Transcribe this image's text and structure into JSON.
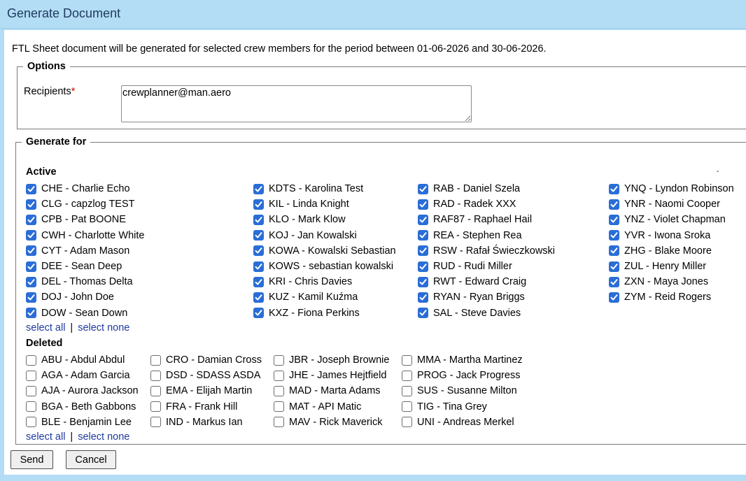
{
  "window": {
    "title": "Generate Document"
  },
  "description": "FTL Sheet document will be generated for selected crew members for the period between 01-06-2026 and 30-06-2026.",
  "options": {
    "legend": "Options",
    "recipients_label": "Recipients",
    "required_mark": "*",
    "recipients_value": "crewplanner@man.aero"
  },
  "generate_for": {
    "legend": "Generate for",
    "active": {
      "title": "Active",
      "columns": [
        [
          "CHE - Charlie Echo",
          "CLG - capzlog TEST",
          "CPB - Pat BOONE",
          "CWH - Charlotte White",
          "CYT - Adam Mason",
          "DEE - Sean Deep",
          "DEL - Thomas Delta",
          "DOJ - John Doe",
          "DOW - Sean Down"
        ],
        [
          "KDTS - Karolina Test",
          "KIL - Linda Knight",
          "KLO - Mark Klow",
          "KOJ - Jan Kowalski",
          "KOWA - Kowalski Sebastian",
          "KOWS - sebastian kowalski",
          "KRI - Chris Davies",
          "KUZ - Kamil Kuźma",
          "KXZ - Fiona Perkins"
        ],
        [
          "RAB - Daniel Szela",
          "RAD - Radek XXX",
          "RAF87 - Raphael Hail",
          "REA - Stephen Rea",
          "RSW - Rafał Świeczkowski",
          "RUD - Rudi Miller",
          "RWT - Edward Craig",
          "RYAN - Ryan Briggs",
          "SAL - Steve Davies"
        ],
        [
          "YNQ - Lyndon Robinson",
          "YNR - Naomi Cooper",
          "YNZ - Violet Chapman",
          "YVR - Iwona Sroka",
          "ZHG - Blake Moore",
          "ZUL - Henry Miller",
          "ZXN - Maya Jones",
          "ZYM - Reid Rogers"
        ]
      ],
      "checked": true
    },
    "deleted": {
      "title": "Deleted",
      "columns": [
        [
          "ABU - Abdul Abdul",
          "AGA - Adam Garcia",
          "AJA - Aurora Jackson",
          "BGA - Beth Gabbons",
          "BLE - Benjamin Lee"
        ],
        [
          "CRO - Damian Cross",
          "DSD - SDASS ASDA",
          "EMA - Elijah Martin",
          "FRA - Frank Hill",
          "IND - Markus Ian"
        ],
        [
          "JBR - Joseph Brownie",
          "JHE - James Hejtfield",
          "MAD - Marta Adams",
          "MAT - API Matic",
          "MAV - Rick Maverick"
        ],
        [
          "MMA - Martha Martinez",
          "PROG - Jack Progress",
          "SUS - Susanne Milton",
          "TIG - Tina Grey",
          "UNI - Andreas Merkel"
        ]
      ],
      "checked": false
    },
    "select_all": "select all",
    "select_none": "select none",
    "separator": "|",
    "stray_mark": "-"
  },
  "buttons": {
    "send": "Send",
    "cancel": "Cancel"
  },
  "colors": {
    "title_bar": "#b3dcf5",
    "checkbox_on": "#2a6dd6",
    "link": "#1f3aa0"
  }
}
